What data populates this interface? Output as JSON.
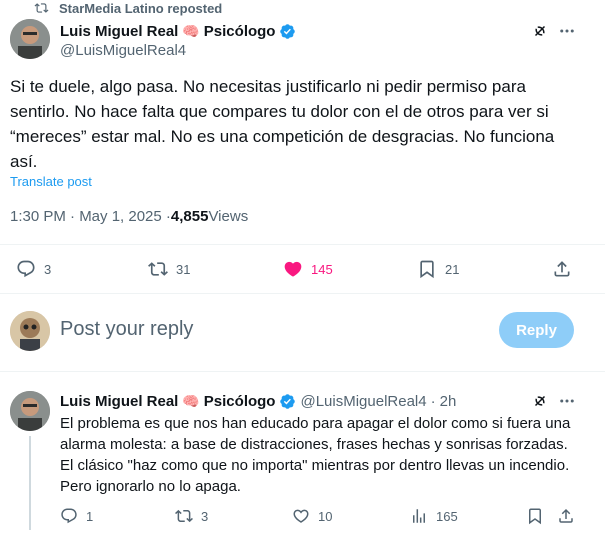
{
  "repost": {
    "label": "StarMedia Latino reposted"
  },
  "main_post": {
    "author_name": "Luis Miguel Real",
    "emoji": "🧠",
    "author_role": "Psicólogo",
    "handle": "@LuisMiguelReal4",
    "text": "Si te duele, algo pasa. No necesitas justificarlo ni pedir permiso para sentirlo. No hace falta que compares tu dolor con el de otros para ver si “mereces” estar mal. No es una competición de desgracias. No funciona así.",
    "translate": "Translate post",
    "time": "1:30 PM · May 1, 2025 · ",
    "views_count": "4,855",
    "views_label": " Views",
    "replies": "3",
    "reposts": "31",
    "likes": "145",
    "bookmarks": "21"
  },
  "reply_box": {
    "placeholder": "Post your reply",
    "button": "Reply"
  },
  "reply_post": {
    "author_name": "Luis Miguel Real",
    "emoji": "🧠",
    "author_role": "Psicólogo",
    "handle": "@LuisMiguelReal4",
    "dot": "·",
    "age": "2h",
    "text": "El problema es que nos han educado para apagar el dolor como si fuera una alarma molesta: a base de distracciones, frases hechas y sonrisas forzadas. El clásico \"haz como que no importa\" mientras por dentro llevas un incendio. Pero ignorarlo no lo apaga.",
    "replies": "1",
    "reposts": "3",
    "likes": "10",
    "views": "165"
  },
  "colors": {
    "accent": "#1d9bf0",
    "like": "#f91880",
    "reply_btn": "#8ecdf8",
    "muted": "#536471"
  },
  "icons": [
    "repost-icon",
    "verified-icon",
    "grok-icon",
    "more-icon",
    "reply-icon",
    "heart-icon",
    "bookmark-icon",
    "share-icon",
    "views-icon"
  ]
}
